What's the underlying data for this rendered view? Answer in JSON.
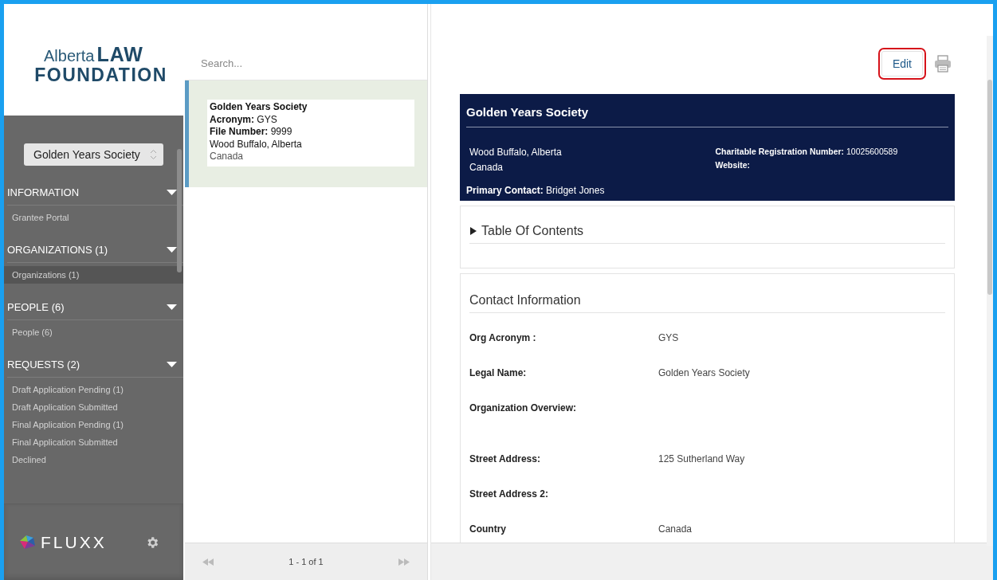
{
  "logo": {
    "word1": "Alberta",
    "word2": "LAW",
    "word3": "FOUNDATION"
  },
  "sidebar": {
    "selector": "Golden Years Society",
    "sections": [
      {
        "title": "INFORMATION",
        "expanded": true,
        "items": [
          {
            "label": "Grantee Portal",
            "selected": false
          }
        ]
      },
      {
        "title": "ORGANIZATIONS (1)",
        "expanded": true,
        "items": [
          {
            "label": "Organizations  (1)",
            "selected": true
          }
        ]
      },
      {
        "title": "PEOPLE (6)",
        "expanded": true,
        "items": [
          {
            "label": "People  (6)",
            "selected": false
          }
        ]
      },
      {
        "title": "REQUESTS (2)",
        "expanded": true,
        "items": [
          {
            "label": "Draft Application Pending  (1)",
            "selected": false
          },
          {
            "label": "Draft Application Submitted",
            "selected": false
          },
          {
            "label": "Final Application Pending  (1)",
            "selected": false
          },
          {
            "label": "Final Application Submitted",
            "selected": false
          },
          {
            "label": "Declined",
            "selected": false
          }
        ]
      }
    ],
    "brand": "FLUXX"
  },
  "list": {
    "search_placeholder": "Search...",
    "records": [
      {
        "name": "Golden Years Society",
        "acronym_label": "Acronym:",
        "acronym": "GYS",
        "file_label": "File Number:",
        "file": "9999",
        "city": "Wood Buffalo, Alberta",
        "country": "Canada",
        "selected": true
      }
    ],
    "pager": "1 - 1 of 1"
  },
  "detail": {
    "edit": {
      "label": "Edit",
      "highlighted": true
    },
    "header": {
      "title": "Golden Years Society",
      "city": "Wood Buffalo, Alberta",
      "country": "Canada",
      "registration_label": "Charitable Registration Number:",
      "registration": "10025600589",
      "website_label": "Website:",
      "contact_label": "Primary Contact:",
      "contact": "Bridget Jones"
    },
    "toc": {
      "title": "Table Of Contents",
      "expanded": false
    },
    "section_title": "Contact Information",
    "fields": [
      {
        "label": "Org Acronym :",
        "value": "GYS"
      },
      {
        "label": "Legal Name:",
        "value": "Golden Years Society"
      },
      {
        "label": "Organization Overview:",
        "kind": "tall"
      },
      {
        "label": "Street Address:",
        "value": "125 Sutherland Way"
      },
      {
        "label": "Street Address 2:"
      },
      {
        "label": "Country",
        "value": "Canada"
      }
    ]
  }
}
